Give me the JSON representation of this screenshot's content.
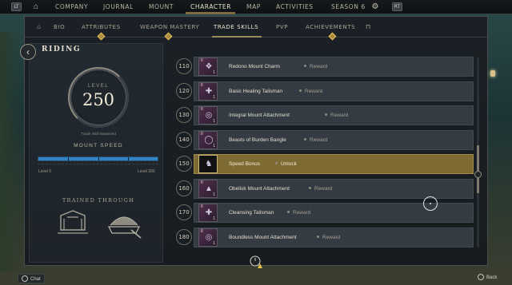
{
  "topbar": {
    "left_badge": "LT",
    "right_badge": "RT",
    "items": [
      {
        "label": "COMPANY"
      },
      {
        "label": "JOURNAL"
      },
      {
        "label": "MOUNT"
      },
      {
        "label": "CHARACTER"
      },
      {
        "label": "MAP"
      },
      {
        "label": "ACTIVITIES"
      },
      {
        "label": "SEASON 6"
      }
    ],
    "active": "CHARACTER"
  },
  "subnav": {
    "items": [
      {
        "label": "BIO"
      },
      {
        "label": "ATTRIBUTES"
      },
      {
        "label": "WEAPON MASTERY"
      },
      {
        "label": "TRADE SKILLS"
      },
      {
        "label": "PVP"
      },
      {
        "label": "ACHIEVEMENTS"
      }
    ],
    "active": "TRADE SKILLS"
  },
  "skill": {
    "title": "RIDING",
    "level_label": "LEVEL",
    "level": "250",
    "mastered": "Trade Skill Mastered",
    "speed_title": "MOUNT SPEED",
    "speed_progress": 1.0,
    "speed_min_label": "Level 0",
    "speed_max_label": "Level 200",
    "trained_title": "TRAINED THROUGH"
  },
  "rewards": [
    {
      "level": "110",
      "name": "Redono Mount Charm",
      "type": "Reward",
      "tier": "II",
      "qty": "1",
      "icon": "charm-icon",
      "highlight": false
    },
    {
      "level": "120",
      "name": "Basic Healing Talisman",
      "type": "Reward",
      "tier": "II",
      "qty": "1",
      "icon": "talisman-icon",
      "highlight": false
    },
    {
      "level": "130",
      "name": "Integral Mount Attachment",
      "type": "Reward",
      "tier": "II",
      "qty": "1",
      "icon": "attachment-icon",
      "highlight": false
    },
    {
      "level": "140",
      "name": "Beasts of Burden Bangle",
      "type": "Reward",
      "tier": "II",
      "qty": "1",
      "icon": "bangle-icon",
      "highlight": false
    },
    {
      "level": "150",
      "name": "Speed Bonus",
      "type": "Unlock",
      "tier": "",
      "qty": "",
      "icon": "horse-icon",
      "highlight": true
    },
    {
      "level": "160",
      "name": "Obelisk Mount Attachment",
      "type": "Reward",
      "tier": "II",
      "qty": "1",
      "icon": "obelisk-icon",
      "highlight": false
    },
    {
      "level": "170",
      "name": "Cleansing Talisman",
      "type": "Reward",
      "tier": "II",
      "qty": "1",
      "icon": "talisman-icon",
      "highlight": false
    },
    {
      "level": "180",
      "name": "Boundless Mount Attachment",
      "type": "Reward",
      "tier": "II",
      "qty": "1",
      "icon": "attachment-icon",
      "highlight": false
    }
  ],
  "footer": {
    "chat": "Chat",
    "back": "Back"
  },
  "colors": {
    "accent_gold": "#a98a3d",
    "highlight_row": "#7e6a33",
    "speed_bar": "#2f85c7"
  }
}
